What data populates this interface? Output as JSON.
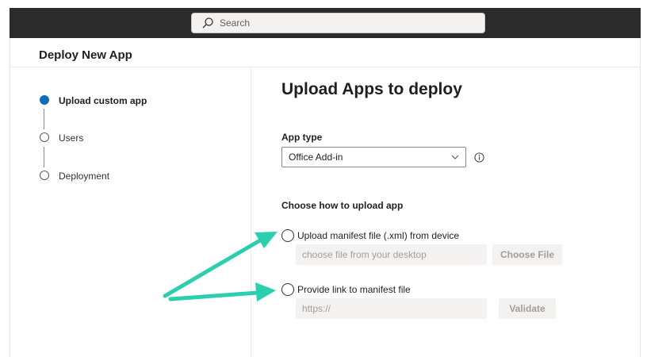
{
  "search": {
    "placeholder": "Search"
  },
  "page": {
    "title": "Deploy New App"
  },
  "steps": [
    {
      "label": "Upload custom app",
      "state": "active"
    },
    {
      "label": "Users",
      "state": "inactive"
    },
    {
      "label": "Deployment",
      "state": "inactive"
    }
  ],
  "main": {
    "heading": "Upload Apps to deploy",
    "app_type_label": "App type",
    "app_type_value": "Office Add-in",
    "choose_heading": "Choose how to upload app",
    "options": [
      {
        "label": "Upload manifest file (.xml) from device",
        "field_placeholder": "choose file from your desktop",
        "button": "Choose File"
      },
      {
        "label": "Provide link to manifest file",
        "field_placeholder": "https://",
        "button": "Validate"
      }
    ]
  },
  "colors": {
    "accent": "#0f6cbd",
    "arrow": "#2bcfae",
    "topbar": "#2b2b2b"
  }
}
